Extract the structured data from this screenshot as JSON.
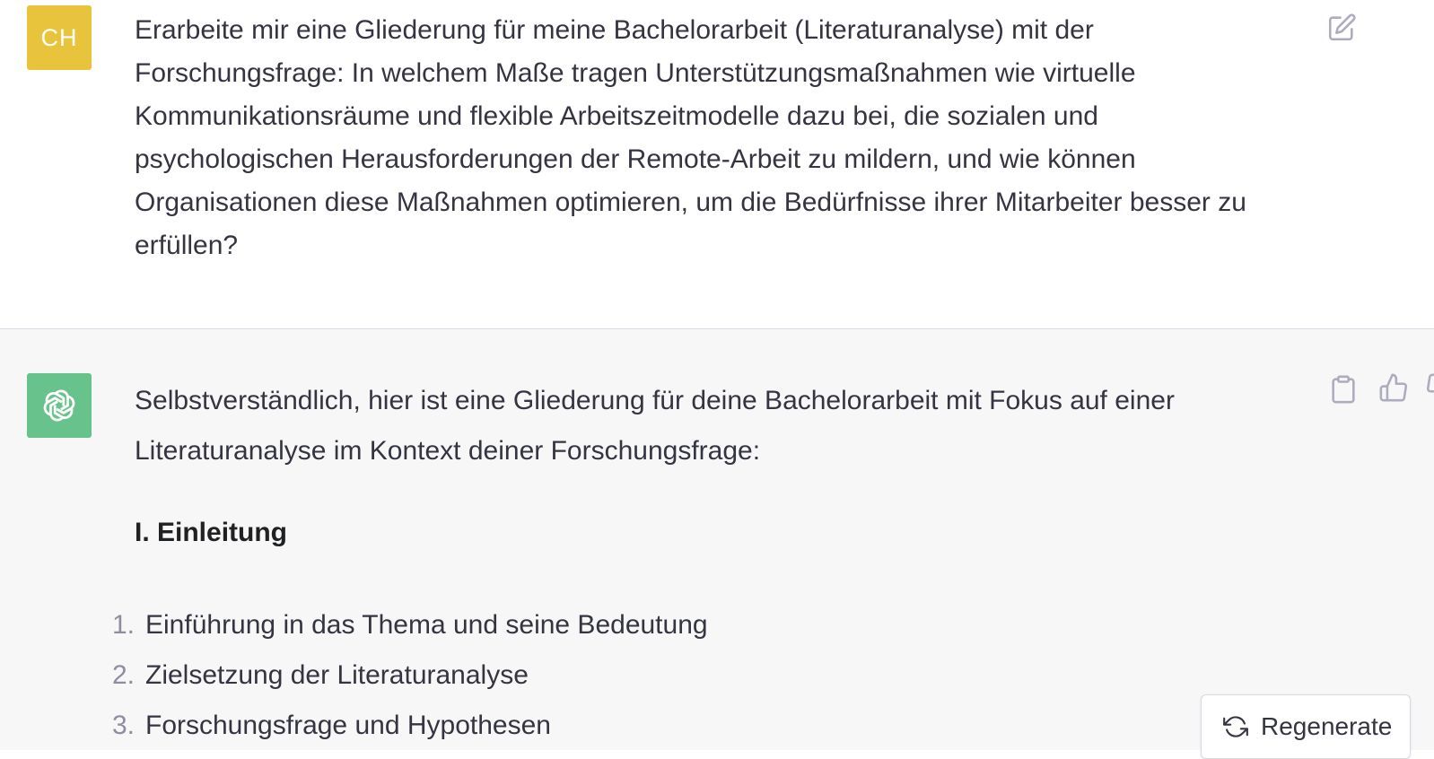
{
  "user_message": {
    "avatar_initials": "CH",
    "avatar_color": "#e7c43b",
    "text": "Erarbeite mir eine Gliederung für meine Bachelorarbeit (Literaturanalyse) mit der Forschungsfrage: In welchem Maße tragen Unterstützungsmaßnahmen wie virtuelle Kommunikationsräume und flexible Arbeitszeitmodelle dazu bei, die sozialen und psychologischen Herausforderungen der Remote-Arbeit zu mildern, und wie können Organisationen diese Maßnahmen optimieren, um die Bedürfnisse ihrer Mitarbeiter besser zu erfüllen?",
    "edit_icon": "edit-icon"
  },
  "assistant_message": {
    "avatar_icon": "openai-logo-icon",
    "avatar_color": "#5bbf82",
    "intro": "Selbstverständlich, hier ist eine Gliederung für deine Bachelorarbeit mit Fokus auf einer Literaturanalyse im Kontext deiner Forschungsfrage:",
    "section_heading": "I. Einleitung",
    "items": [
      {
        "num": "1.",
        "text": "Einführung in das Thema und seine Bedeutung"
      },
      {
        "num": "2.",
        "text": "Zielsetzung der Literaturanalyse"
      },
      {
        "num": "3.",
        "text": "Forschungsfrage und Hypothesen"
      }
    ],
    "action_icons": [
      "copy-icon",
      "thumbs-up-icon",
      "thumbs-down-icon"
    ]
  },
  "regenerate_button": {
    "label": "Regenerate",
    "icon": "refresh-icon"
  }
}
